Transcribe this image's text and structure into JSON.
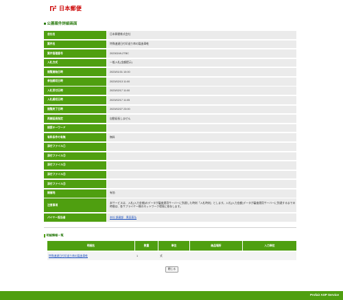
{
  "header": {
    "logo_text": "日本郵便",
    "logo_mark": "jp-post-logo-icon"
  },
  "page_title": "公募案件詳細画面",
  "detail_rows": [
    {
      "label": "会社名",
      "value": "日本郵便株式会社"
    },
    {
      "label": "案件名",
      "value": "特殊速達日付印送り串の製造車乾"
    },
    {
      "label": "案件管理番号",
      "value": "20230249-2TBC"
    },
    {
      "label": "入札方式",
      "value": "一般入札(金額提示)"
    },
    {
      "label": "閲覧開始日時",
      "value": "2023/01/31 10:00"
    },
    {
      "label": "参加締切日時",
      "value": "2023/02/13 11:00"
    },
    {
      "label": "入札受付日時",
      "value": "2023/02/17 11:00"
    },
    {
      "label": "入札締切日時",
      "value": "2023/02/17 11:05"
    },
    {
      "label": "閲覧終了日時",
      "value": "2023/02/27 23:00"
    },
    {
      "label": "再開延長指定",
      "value": "自動延長しません"
    },
    {
      "label": "検索キーワード",
      "value": ""
    },
    {
      "label": "有料条件の有無",
      "value": "無料"
    },
    {
      "label": "添付ファイル①",
      "value": ""
    },
    {
      "label": "添付ファイル②",
      "value": ""
    },
    {
      "label": "添付ファイル③",
      "value": ""
    },
    {
      "label": "添付ファイル④",
      "value": ""
    },
    {
      "label": "添付ファイル⑤",
      "value": ""
    },
    {
      "label": "開催地",
      "value": "有効"
    },
    {
      "label": "注意事項",
      "value": "本サービスは、入札(入力金額)のデータが審査運用サーバーに到達した時刻「入札時刻」とします。入札(入力金額)データが審査運用サーバーに到達するまでの時間は、各サプライヤー様のネットワーク環境に依存します。"
    },
    {
      "label": "バイヤー担当者",
      "value": "本社 調達部　黒田直弘",
      "is_link": true
    }
  ],
  "items_section": {
    "title": "明細情報一覧",
    "columns": [
      "明細名",
      "数量",
      "単位",
      "納品場所",
      "入力単位"
    ],
    "rows": [
      {
        "name": "特殊速達日付印送り串の製造車乾",
        "qty": "1",
        "unit": "式",
        "place": "",
        "input_unit": ""
      }
    ]
  },
  "close_button": "閉じる",
  "footer": {
    "text": "Profair ASP Service"
  },
  "colors": {
    "accent_green": "#4f9f10",
    "title_green": "#2e7d14",
    "logo_red": "#cc0000"
  }
}
